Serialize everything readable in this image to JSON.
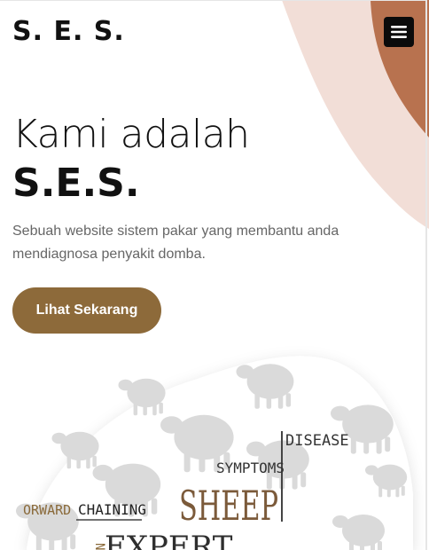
{
  "header": {
    "brand": "S. E. S.",
    "menu_icon": "hamburger-menu-icon"
  },
  "hero": {
    "title_line1": "Kami adalah",
    "title_line2": "S.E.S.",
    "description": "Sebuah website sistem pakar yang membantu anda mendiagnosa penyakit domba.",
    "cta_label": "Lihat Sekarang"
  },
  "illustration": {
    "words": {
      "disease": "DISEASE",
      "symptoms": "SYMPTOMS",
      "sheep": "SHEEP",
      "forward": "ORWARD",
      "chaining": "CHAINING",
      "expert": "EXPERT",
      "vertical": "N"
    }
  },
  "colors": {
    "accent": "#8d6a3a",
    "blob_light": "#f2ded7",
    "blob_dark": "#b8724f",
    "sheep_gray": "#dadada"
  }
}
